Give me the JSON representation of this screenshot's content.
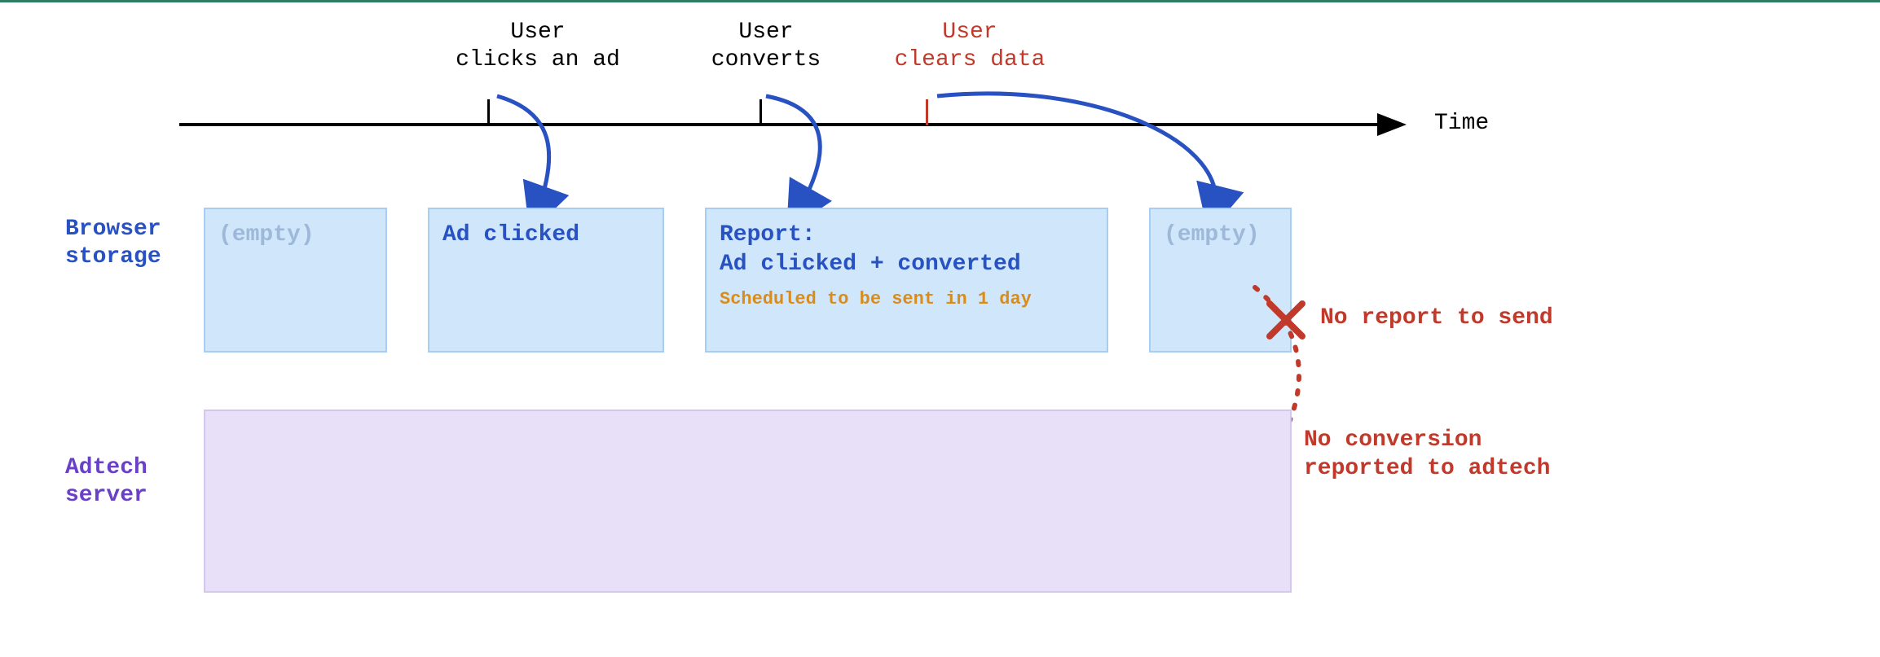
{
  "timeline": {
    "axis_label": "Time",
    "events": {
      "click": {
        "line1": "User",
        "line2": "clicks an ad"
      },
      "convert": {
        "line1": "User",
        "line2": "converts"
      },
      "clear": {
        "line1": "User",
        "line2": "clears data"
      }
    }
  },
  "rows": {
    "browser_label_line1": "Browser",
    "browser_label_line2": "storage",
    "adtech_label_line1": "Adtech",
    "adtech_label_line2": "server"
  },
  "storage_states": {
    "s0": "(empty)",
    "s1": "Ad clicked",
    "s2_line1": "Report:",
    "s2_line2": "Ad clicked + converted",
    "s2_sched": "Scheduled to be sent in 1 day",
    "s3": "(empty)"
  },
  "failure": {
    "no_report": "No report to send",
    "no_conv_line1": "No conversion",
    "no_conv_line2": "reported to adtech"
  },
  "colors": {
    "blue": "#2851C2",
    "purple": "#6a40c9",
    "red": "#c0392b",
    "orange": "#d98c1a",
    "boxbg": "#cfe6fb",
    "lanebg": "#e8dff9"
  }
}
